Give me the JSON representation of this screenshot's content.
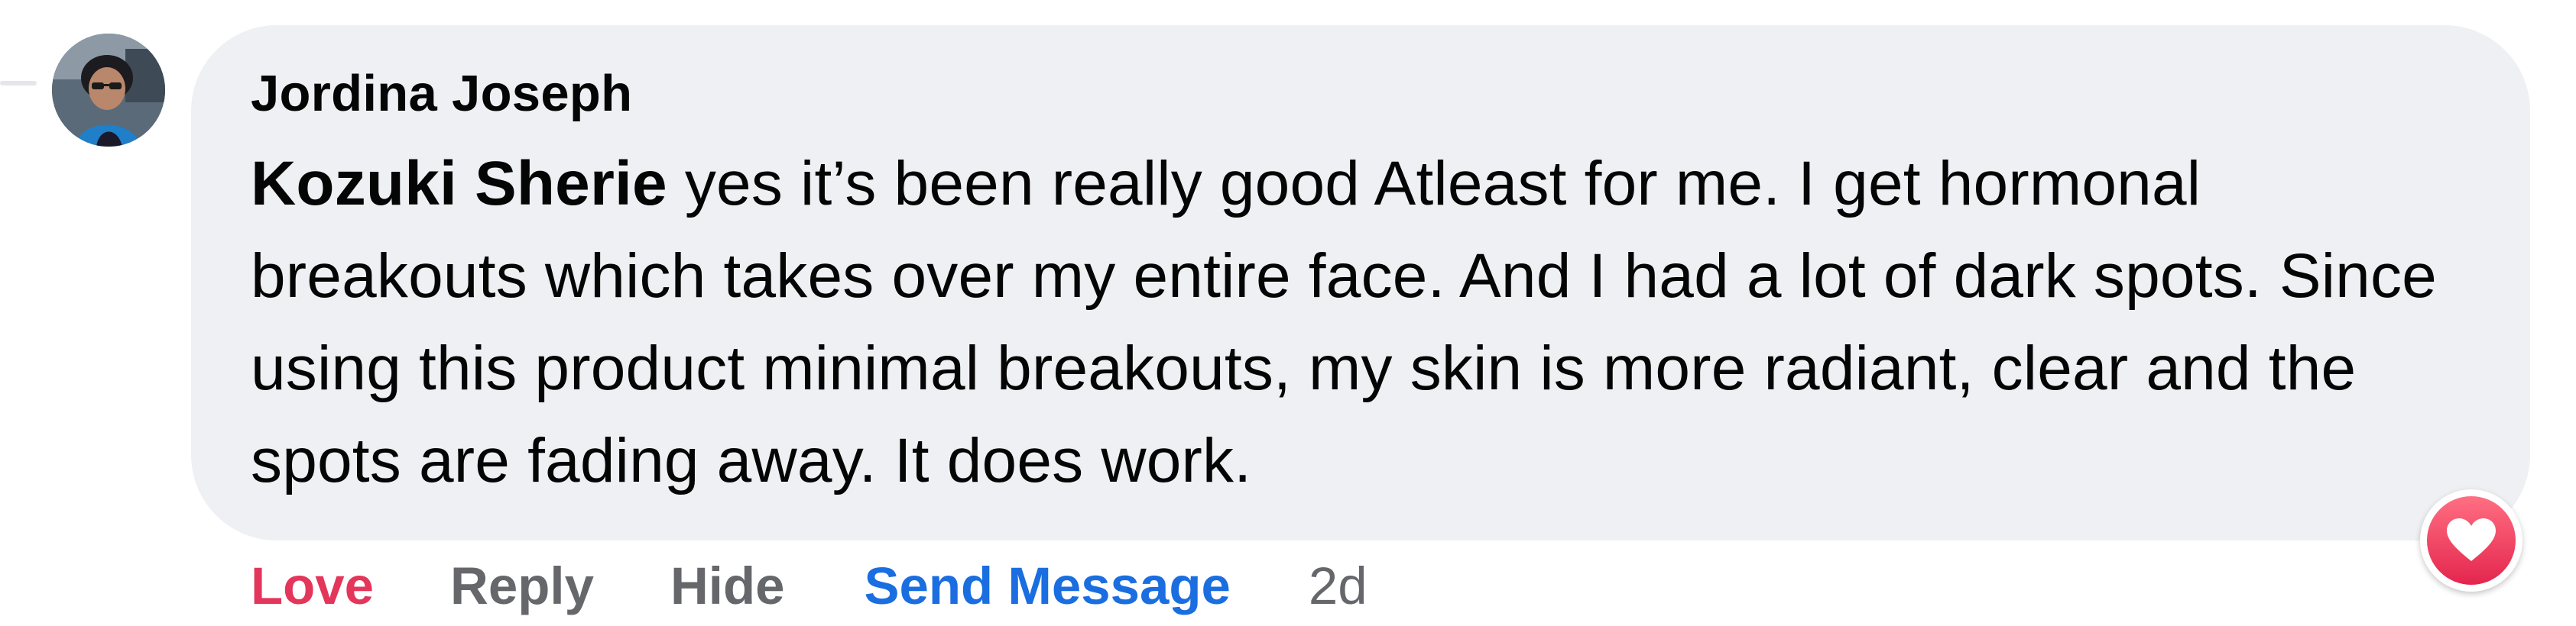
{
  "comment": {
    "author": "Jordina Joseph",
    "mention": "Kozuki Sherie",
    "text": " yes it’s been really good Atleast for me. I get hormonal breakouts which takes over my entire face. And I had a lot of dark spots. Since using this product minimal breakouts, my skin is more radiant, clear and the spots are fading away. It does work.",
    "reaction": "heart-icon"
  },
  "actions": {
    "love": "Love",
    "reply": "Reply",
    "hide": "Hide",
    "send_message": "Send Message",
    "timestamp": "2d"
  },
  "colors": {
    "bubble": "#eef0f3",
    "love": "#e4355a",
    "link_blue": "#1a6ee0",
    "muted": "#65676b"
  }
}
